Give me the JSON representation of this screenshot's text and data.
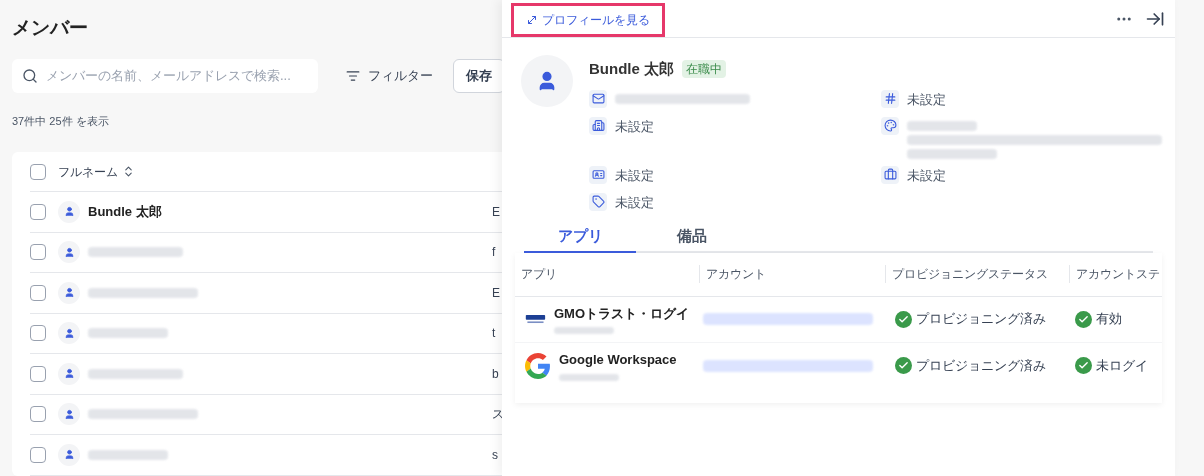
{
  "page": {
    "title": "メンバー",
    "search": {
      "placeholder": "メンバーの名前、メールアドレスで検索..."
    },
    "filter_button": "フィルター",
    "saved_button": "保存",
    "count": "37件中 25件 を表示"
  },
  "table": {
    "columns": [
      "フルネーム"
    ],
    "all_selected": false,
    "rows": [
      {
        "name": "Bundle 太郎",
        "column_2": "E",
        "selected": false
      },
      {
        "column_2": "f",
        "selected": false
      },
      {
        "column_2": "E",
        "selected": false
      },
      {
        "column_2": "t",
        "selected": false
      },
      {
        "column_2": "b",
        "selected": false
      },
      {
        "column_2": "ス",
        "selected": false
      },
      {
        "column_2": "s",
        "selected": false
      }
    ]
  },
  "panel": {
    "view_profile_link": "プロフィールを見る",
    "name": "Bundle 太郎",
    "status_badge": "在職中",
    "fields": [
      {
        "kind": "redacted"
      },
      {
        "kind": "text",
        "value": "未設定"
      },
      {
        "kind": "text",
        "value": "未設定"
      },
      {
        "kind": "redacted"
      },
      {
        "kind": "text",
        "value": "未設定"
      },
      {
        "kind": "text",
        "value": "未設定"
      },
      {
        "kind": "text",
        "value": "未設定"
      }
    ],
    "tabs": [
      {
        "label": "アプリ",
        "selected": true
      },
      {
        "label": "備品",
        "selected": false
      }
    ],
    "apps_table": {
      "columns": [
        "アプリ",
        "アカウント",
        "プロビジョニングステータス",
        "アカウントステ"
      ],
      "rows": [
        {
          "app": "GMOトラスト・ログイ",
          "provisioning": "プロビジョニング済み",
          "account_status": "有効"
        },
        {
          "app": "Google Workspace",
          "provisioning": "プロビジョニング済み",
          "account_status": "未ログイ"
        }
      ]
    }
  }
}
